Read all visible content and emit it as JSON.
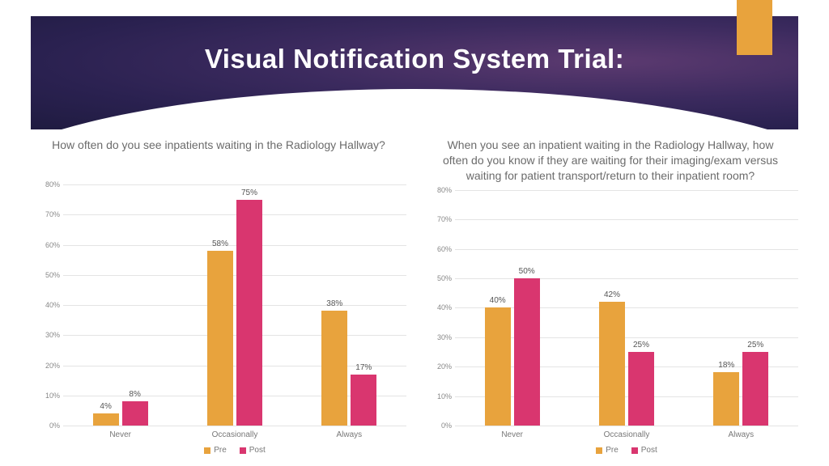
{
  "header": {
    "title": "Visual Notification System Trial:"
  },
  "legend": {
    "pre": "Pre",
    "post": "Post"
  },
  "chart_data": [
    {
      "type": "bar",
      "title": "How often do you see inpatients waiting in the Radiology Hallway?",
      "categories": [
        "Never",
        "Occasionally",
        "Always"
      ],
      "series": [
        {
          "name": "Pre",
          "values": [
            4,
            58,
            38
          ]
        },
        {
          "name": "Post",
          "values": [
            8,
            75,
            17
          ]
        }
      ],
      "ylabel": "",
      "ylim": [
        0,
        80
      ],
      "ytick_step": 10,
      "value_suffix": "%"
    },
    {
      "type": "bar",
      "title": "When you see an inpatient waiting in the Radiology Hallway, how often do you know if they are waiting for their imaging/exam versus waiting for patient transport/return to their inpatient room?",
      "categories": [
        "Never",
        "Occasionally",
        "Always"
      ],
      "series": [
        {
          "name": "Pre",
          "values": [
            40,
            42,
            18
          ]
        },
        {
          "name": "Post",
          "values": [
            50,
            25,
            25
          ]
        }
      ],
      "ylabel": "",
      "ylim": [
        0,
        80
      ],
      "ytick_step": 10,
      "value_suffix": "%"
    }
  ]
}
